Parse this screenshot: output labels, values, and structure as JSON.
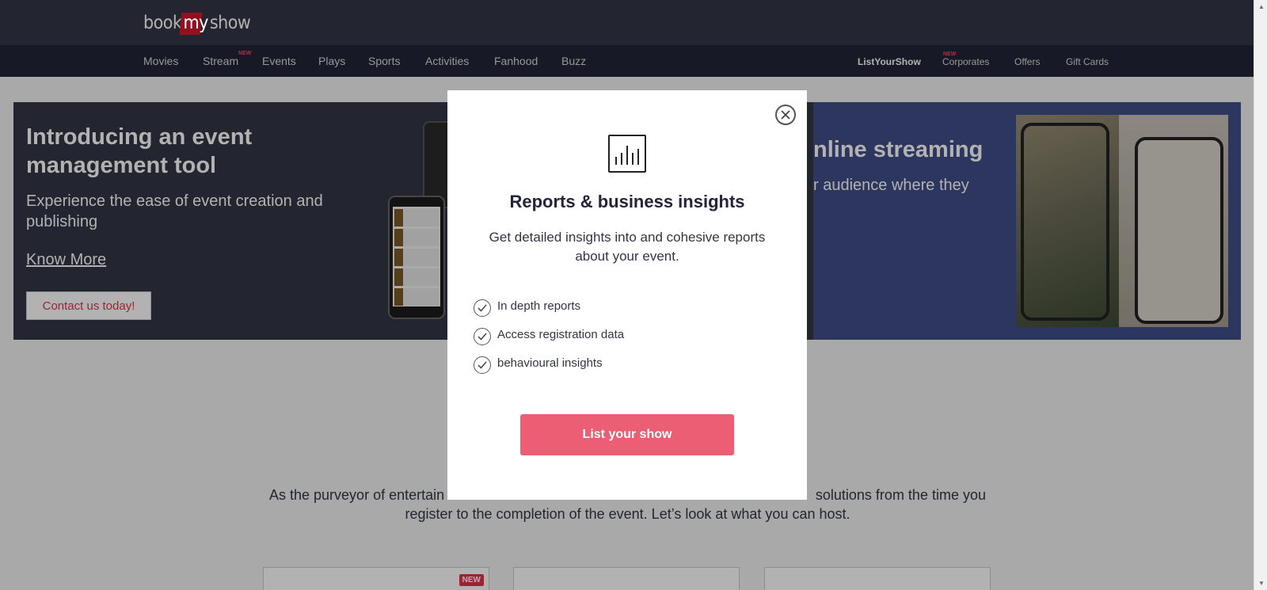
{
  "header": {
    "logo": {
      "part1": "book",
      "part2": "my",
      "part3": "show"
    }
  },
  "nav": {
    "left": [
      {
        "label": "Movies"
      },
      {
        "label": "Stream",
        "badge": "NEW"
      },
      {
        "label": "Events"
      },
      {
        "label": "Plays"
      },
      {
        "label": "Sports"
      },
      {
        "label": "Activities"
      },
      {
        "label": "Fanhood"
      },
      {
        "label": "Buzz"
      }
    ],
    "right": [
      {
        "label": "ListYourShow"
      },
      {
        "label": "Corporates",
        "badge": "NEW"
      },
      {
        "label": "Offers"
      },
      {
        "label": "Gift Cards"
      }
    ]
  },
  "banner": {
    "left": {
      "title": "Introducing an event management tool",
      "subtitle": "Experience the ease of event creation and publishing",
      "link": "Know More",
      "cta": "Contact us today!"
    },
    "right": {
      "title": "nline streaming",
      "subtitle": "r audience where they"
    }
  },
  "content": {
    "paragraph_left": "As the purveyor of entertain",
    "paragraph_right": "solutions from the time you",
    "paragraph_line2": "register to the completion of the event. Let’s look at what you can host.",
    "card_badge": "NEW"
  },
  "modal": {
    "icon": "bar-chart-icon",
    "title": "Reports & business insights",
    "description": "Get detailed insights into and cohesive reports about your event.",
    "features": [
      "In depth reports",
      "Access registration data",
      "behavioural insights"
    ],
    "cta": "List your show"
  },
  "colors": {
    "header_bg": "#333545",
    "nav_bg": "#222539",
    "brand_red": "#dc354b",
    "cta_pink": "#ec5e73",
    "banner_right_bg": "#3f4e87"
  }
}
